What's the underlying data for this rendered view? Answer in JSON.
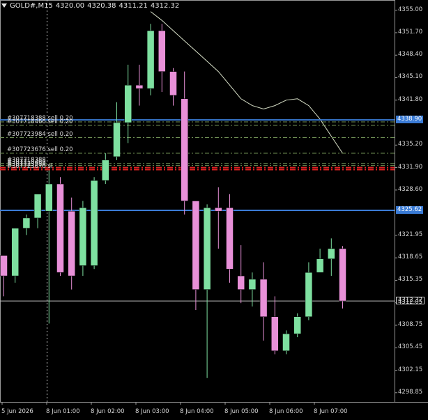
{
  "header": {
    "symbol": "GOLD#,M15",
    "open": "4320.00",
    "high": "4320.38",
    "low": "4311.21",
    "close": "4312.32"
  },
  "colors": {
    "background": "#000000",
    "bull": "#7ee0a0",
    "bear": "#e890d8",
    "level_line": "#3a7bd5",
    "order_line": "#6f8f55",
    "sl_line": "#e02020",
    "ma_line": "#d8e0c8"
  },
  "price_scale": {
    "labels": [
      "4355.00",
      "4351.70",
      "4348.40",
      "4345.10",
      "4341.80",
      "4335.20",
      "4331.90",
      "4328.60",
      "4321.95",
      "4318.65",
      "4315.35",
      "4312.05",
      "4308.75",
      "4305.45",
      "4302.15",
      "4298.85"
    ],
    "current_price_tag": "4312.32",
    "level_tags": [
      "4338.90",
      "4325.62"
    ]
  },
  "time_axis": {
    "labels": [
      "5 Jun 2026",
      "8 Jun 01:00",
      "8 Jun 02:00",
      "8 Jun 03:00",
      "8 Jun 04:00",
      "8 Jun 05:00",
      "8 Jun 06:00",
      "8 Jun 07:00"
    ]
  },
  "orders": [
    {
      "label": "#307718388 sell 0.20",
      "price": 4338.6
    },
    {
      "label": "#307718466 sell 0.20",
      "price": 4338.1
    },
    {
      "label": "#307723984 sell 0.20",
      "price": 4336.3
    },
    {
      "label": "#307723676 sell 0.20",
      "price": 4334.0
    },
    {
      "label": "#307718388",
      "price": 4332.5
    },
    {
      "label": "#307718466",
      "price": 4332.2
    },
    {
      "label": "#307723984",
      "price": 4331.9
    },
    {
      "label": "#307723676 sl",
      "price": 4331.6
    }
  ],
  "chart_data": {
    "type": "candlestick",
    "series": [
      {
        "name": "",
        "o": 4319.0,
        "h": 4319.0,
        "l": 4313.0,
        "c": 4316.0
      },
      {
        "name": "",
        "o": 4316.0,
        "h": 4323.0,
        "l": 4315.0,
        "c": 4323.0
      },
      {
        "name": "",
        "o": 4323.0,
        "h": 4325.0,
        "l": 4322.0,
        "c": 4324.5
      },
      {
        "name": "",
        "o": 4324.5,
        "h": 4328.0,
        "l": 4323.0,
        "c": 4328.0
      },
      {
        "name": "",
        "o": 4325.5,
        "h": 4331.5,
        "l": 4309.0,
        "c": 4329.5
      },
      {
        "name": "",
        "o": 4329.5,
        "h": 4330.5,
        "l": 4316.0,
        "c": 4316.5
      },
      {
        "name": "",
        "o": 4325.5,
        "h": 4327.5,
        "l": 4314.0,
        "c": 4316.0
      },
      {
        "name": "",
        "o": 4317.5,
        "h": 4327.0,
        "l": 4316.0,
        "c": 4326.0
      },
      {
        "name": "",
        "o": 4317.5,
        "h": 4330.5,
        "l": 4317.0,
        "c": 4330.0
      },
      {
        "name": "",
        "o": 4330.0,
        "h": 4334.0,
        "l": 4329.5,
        "c": 4333.0
      },
      {
        "name": "",
        "o": 4333.5,
        "h": 4341.5,
        "l": 4333.0,
        "c": 4338.5
      },
      {
        "name": "",
        "o": 4338.5,
        "h": 4347.0,
        "l": 4335.5,
        "c": 4344.0
      },
      {
        "name": "",
        "o": 4344.0,
        "h": 4347.0,
        "l": 4341.0,
        "c": 4343.5
      },
      {
        "name": "",
        "o": 4343.5,
        "h": 4353.0,
        "l": 4342.5,
        "c": 4352.0
      },
      {
        "name": "",
        "o": 4352.0,
        "h": 4353.0,
        "l": 4343.0,
        "c": 4346.0
      },
      {
        "name": "",
        "o": 4346.0,
        "h": 4346.5,
        "l": 4341.0,
        "c": 4342.5
      },
      {
        "name": "",
        "o": 4342.0,
        "h": 4346.0,
        "l": 4325.0,
        "c": 4327.0
      },
      {
        "name": "",
        "o": 4327.0,
        "h": 4327.0,
        "l": 4311.0,
        "c": 4314.0
      },
      {
        "name": "",
        "o": 4314.0,
        "h": 4326.5,
        "l": 4301.0,
        "c": 4326.0
      },
      {
        "name": "",
        "o": 4326.0,
        "h": 4329.0,
        "l": 4320.0,
        "c": 4325.5
      },
      {
        "name": "",
        "o": 4326.0,
        "h": 4328.0,
        "l": 4315.0,
        "c": 4317.0
      },
      {
        "name": "",
        "o": 4316.0,
        "h": 4320.5,
        "l": 4312.0,
        "c": 4314.0
      },
      {
        "name": "",
        "o": 4314.0,
        "h": 4316.5,
        "l": 4311.5,
        "c": 4315.5
      },
      {
        "name": "",
        "o": 4315.5,
        "h": 4318.0,
        "l": 4306.5,
        "c": 4310.0
      },
      {
        "name": "",
        "o": 4310.0,
        "h": 4313.0,
        "l": 4304.5,
        "c": 4305.0
      },
      {
        "name": "",
        "o": 4305.0,
        "h": 4308.0,
        "l": 4304.5,
        "c": 4307.5
      },
      {
        "name": "",
        "o": 4307.5,
        "h": 4310.5,
        "l": 4307.0,
        "c": 4310.0
      },
      {
        "name": "",
        "o": 4310.0,
        "h": 4318.0,
        "l": 4309.5,
        "c": 4316.5
      },
      {
        "name": "",
        "o": 4316.5,
        "h": 4320.0,
        "l": 4316.5,
        "c": 4318.5
      },
      {
        "name": "",
        "o": 4318.5,
        "h": 4321.5,
        "l": 4316.0,
        "c": 4320.0
      },
      {
        "name": "",
        "o": 4320.0,
        "h": 4320.38,
        "l": 4311.21,
        "c": 4312.32
      }
    ],
    "moving_average": [
      4354.8,
      4353.5,
      4352.0,
      4350.5,
      4349.0,
      4347.5,
      4346.0,
      4344.0,
      4342.0,
      4341.0,
      4340.5,
      4341.0,
      4341.8,
      4342.0,
      4341.0,
      4339.0,
      4336.5,
      4334.0
    ],
    "horizontal_levels": [
      4338.9,
      4325.62
    ],
    "current_price": 4312.32,
    "y_range": [
      4297.5,
      4356.5
    ],
    "x_labels": [
      "5 Jun 2026",
      "8 Jun 01:00",
      "8 Jun 02:00",
      "8 Jun 03:00",
      "8 Jun 04:00",
      "8 Jun 05:00",
      "8 Jun 06:00",
      "8 Jun 07:00"
    ],
    "grid": false
  }
}
